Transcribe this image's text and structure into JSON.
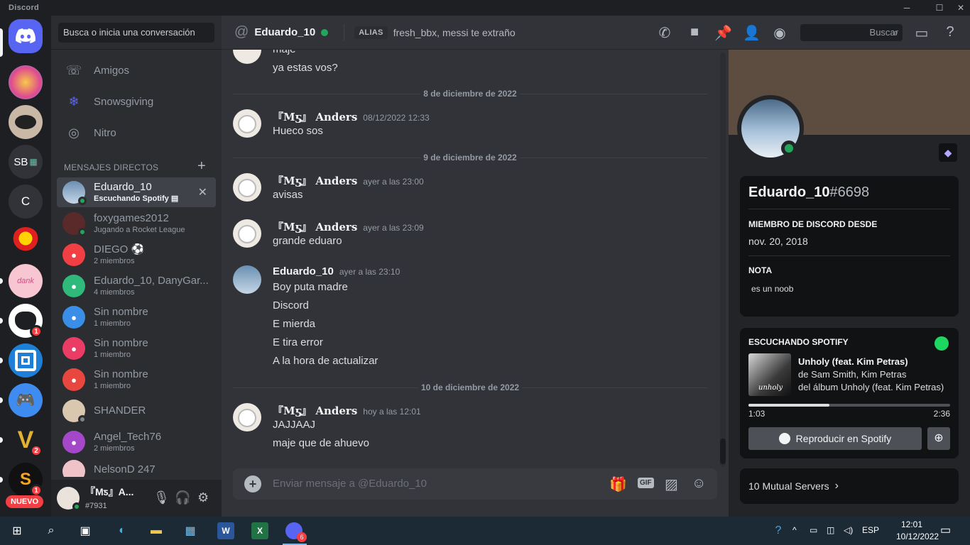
{
  "window": {
    "title": "Discord"
  },
  "servers": {
    "badges": [
      "1",
      "2",
      "1"
    ],
    "sb_label": "SB",
    "c_label": "C",
    "new_label": "NUEVO"
  },
  "dm_sidebar": {
    "search_placeholder": "Busca o inicia una conversación",
    "nav": [
      {
        "label": "Amigos",
        "icon": "friends-icon"
      },
      {
        "label": "Snowsgiving",
        "icon": "snowflake-icon"
      },
      {
        "label": "Nitro",
        "icon": "nitro-icon"
      }
    ],
    "section_title": "MENSAJES DIRECTOS",
    "dms": [
      {
        "name": "Eduardo_10",
        "sub": "Escuchando Spotify",
        "status": "online"
      },
      {
        "name": "foxygames2012",
        "sub": "Jugando a Rocket League",
        "status": "online"
      },
      {
        "name": "DIEGO ⚽",
        "sub": "2 miembros"
      },
      {
        "name": "Eduardo_10, DanyGar...",
        "sub": "4 miembros"
      },
      {
        "name": "Sin nombre",
        "sub": "1 miembro"
      },
      {
        "name": "Sin nombre",
        "sub": "1 miembro"
      },
      {
        "name": "Sin nombre",
        "sub": "1 miembro"
      },
      {
        "name": "SHANDER",
        "sub": "",
        "status": "offline"
      },
      {
        "name": "Angel_Tech76",
        "sub": "2 miembros"
      },
      {
        "name": "NelsonD 247",
        "sub": ""
      }
    ],
    "user": {
      "name": "『Mƽ』A...",
      "tag": "#7931"
    }
  },
  "header": {
    "name": "Eduardo_10",
    "alias_label": "ALIAS",
    "alias_value": "fresh_bbx, messi te extraño",
    "search_placeholder": "Buscar"
  },
  "chat": {
    "lines_top": [
      "maje",
      "ya estas vos?"
    ],
    "dividers": [
      "8 de diciembre de 2022",
      "9 de diciembre de 2022",
      "10 de diciembre de 2022"
    ],
    "messages": [
      {
        "author": "『Mƽ』 𝐀𝐧𝐝𝐞𝐫𝐬",
        "time": "08/12/2022 12:33",
        "lines": [
          "Hueco sos"
        ]
      },
      {
        "author": "『Mƽ』 𝐀𝐧𝐝𝐞𝐫𝐬",
        "time": "ayer a las 23:00",
        "lines": [
          "avisas"
        ]
      },
      {
        "author": "『Mƽ』 𝐀𝐧𝐝𝐞𝐫𝐬",
        "time": "ayer a las 23:09",
        "lines": [
          "grande eduaro"
        ]
      },
      {
        "author": "Eduardo_10",
        "time": "ayer a las 23:10",
        "lines": [
          "Boy puta madre",
          "Discord",
          "E mierda",
          "E tira error",
          "A la hora de actualizar"
        ]
      },
      {
        "author": "『Mƽ』 𝐀𝐧𝐝𝐞𝐫𝐬",
        "time": "hoy a las 12:01",
        "lines": [
          "JAJJAAJ",
          "maje que de ahuevo"
        ]
      }
    ],
    "composer_placeholder": "Enviar mensaje a @Eduardo_10",
    "gif_label": "GIF"
  },
  "profile": {
    "username": "Eduardo_10",
    "discriminator": "#6698",
    "member_since_title": "MIEMBRO DE DISCORD DESDE",
    "member_since": "nov. 20, 2018",
    "note_title": "NOTA",
    "note": "es un noob",
    "spotify": {
      "title": "ESCUCHANDO SPOTIFY",
      "song": "Unholy (feat. Kim Petras)",
      "artist": "de Sam Smith, Kim Petras",
      "album": "del álbum Unholy (feat. Kim Petras)",
      "album_art_text": "unholy",
      "elapsed": "1:03",
      "duration": "2:36",
      "progress": 0.4,
      "play_label": "Reproducir en Spotify"
    },
    "mutual_label": "10 Mutual Servers"
  },
  "taskbar": {
    "language": "ESP",
    "time": "12:01",
    "date": "10/12/2022",
    "discord_badge": "6"
  },
  "colors": {
    "blurple": "#5865f2",
    "online": "#23a55a",
    "spotify": "#1ed760",
    "red": "#f23f43"
  }
}
